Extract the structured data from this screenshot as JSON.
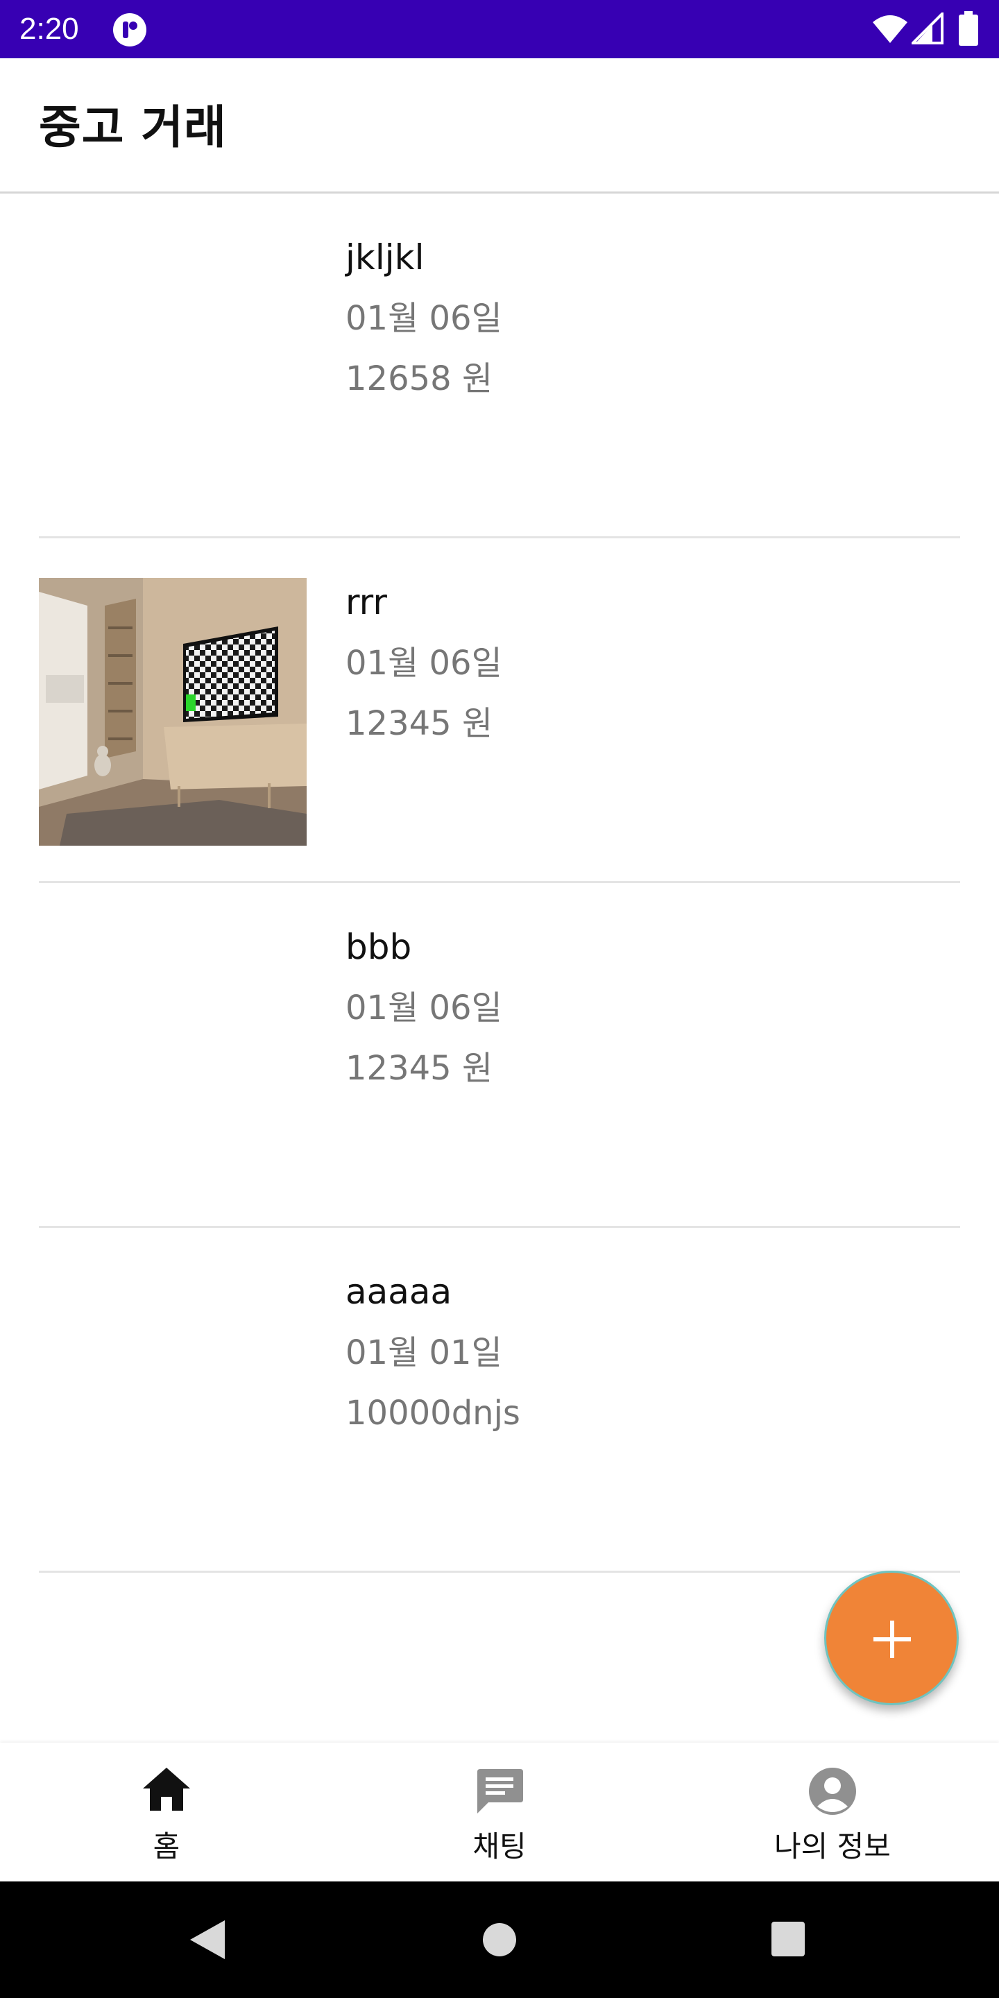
{
  "status_bar": {
    "time": "2:20",
    "icons": [
      "app-notification-icon",
      "wifi-icon",
      "signal-icon",
      "battery-icon"
    ],
    "background": "#3700b3"
  },
  "app_bar": {
    "title": "중고 거래"
  },
  "items": [
    {
      "name": "jkljkl",
      "date": "01월 06일",
      "price": "12658 원",
      "has_image": false
    },
    {
      "name": "rrr",
      "date": "01월 06일",
      "price": "12345 원",
      "has_image": true
    },
    {
      "name": "bbb",
      "date": "01월 06일",
      "price": "12345 원",
      "has_image": false
    },
    {
      "name": "aaaaa",
      "date": "01월 01일",
      "price": "10000dnjs",
      "has_image": false
    }
  ],
  "fab": {
    "icon": "plus-icon",
    "color": "#f08437"
  },
  "bottom_nav": {
    "items": [
      {
        "label": "홈",
        "icon": "home-icon",
        "selected": true
      },
      {
        "label": "채팅",
        "icon": "chat-icon",
        "selected": false
      },
      {
        "label": "나의 정보",
        "icon": "account-icon",
        "selected": false
      }
    ]
  },
  "system_nav": {
    "buttons": [
      "back-icon",
      "home-circle-icon",
      "recents-icon"
    ]
  }
}
